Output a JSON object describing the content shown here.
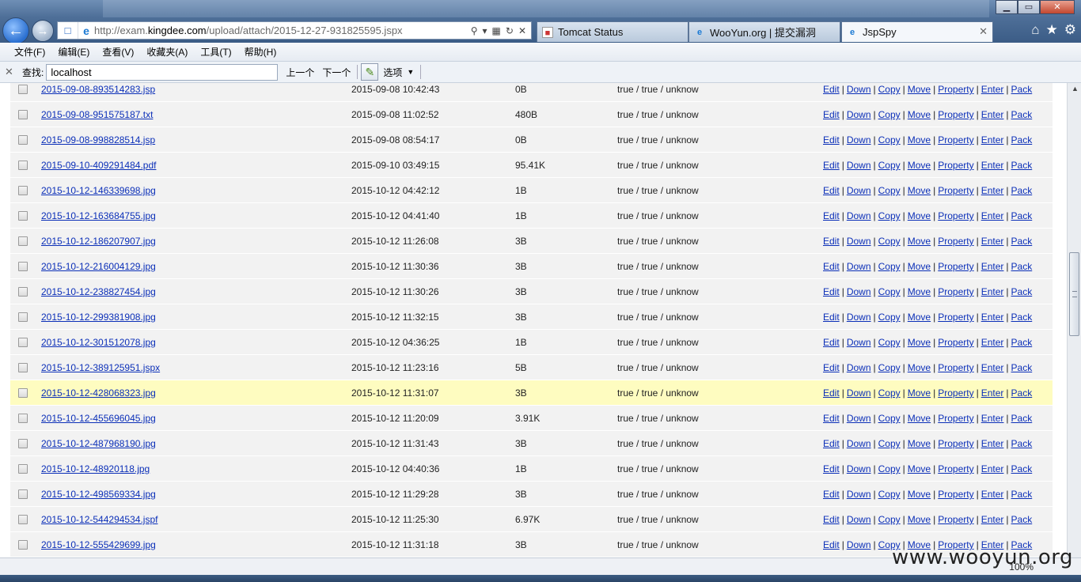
{
  "browser": {
    "address_url_prefix": "http://exam.",
    "address_url_domain": "kingdee.com",
    "address_url_suffix": "/upload/attach/2015-12-27-931825595.jspx",
    "tabs": [
      {
        "label": "Tomcat Status",
        "icon": "tomcat-icon"
      },
      {
        "label": "WooYun.org | 提交漏洞",
        "icon": "ie-icon"
      },
      {
        "label": "JspSpy",
        "icon": "ie-icon",
        "active": true
      }
    ],
    "window_buttons": {
      "minimize": "▁",
      "maximize": "▭",
      "close": "✕"
    }
  },
  "menu": [
    "文件(F)",
    "编辑(E)",
    "查看(V)",
    "收藏夹(A)",
    "工具(T)",
    "帮助(H)"
  ],
  "find": {
    "label": "查找:",
    "value": "localhost",
    "prev": "上一个",
    "next": "下一个",
    "options": "选项"
  },
  "actions": [
    "Edit",
    "Down",
    "Copy",
    "Move",
    "Property",
    "Enter",
    "Pack"
  ],
  "files": [
    {
      "name": "2015-09-08-893514283.jsp",
      "date": "2015-09-08 10:42:43",
      "size": "0B",
      "perm": "true / true / unknow"
    },
    {
      "name": "2015-09-08-951575187.txt",
      "date": "2015-09-08 11:02:52",
      "size": "480B",
      "perm": "true / true / unknow"
    },
    {
      "name": "2015-09-08-998828514.jsp",
      "date": "2015-09-08 08:54:17",
      "size": "0B",
      "perm": "true / true / unknow"
    },
    {
      "name": "2015-09-10-409291484.pdf",
      "date": "2015-09-10 03:49:15",
      "size": "95.41K",
      "perm": "true / true / unknow"
    },
    {
      "name": "2015-10-12-146339698.jpg",
      "date": "2015-10-12 04:42:12",
      "size": "1B",
      "perm": "true / true / unknow"
    },
    {
      "name": "2015-10-12-163684755.jpg",
      "date": "2015-10-12 04:41:40",
      "size": "1B",
      "perm": "true / true / unknow"
    },
    {
      "name": "2015-10-12-186207907.jpg",
      "date": "2015-10-12 11:26:08",
      "size": "3B",
      "perm": "true / true / unknow"
    },
    {
      "name": "2015-10-12-216004129.jpg",
      "date": "2015-10-12 11:30:36",
      "size": "3B",
      "perm": "true / true / unknow"
    },
    {
      "name": "2015-10-12-238827454.jpg",
      "date": "2015-10-12 11:30:26",
      "size": "3B",
      "perm": "true / true / unknow"
    },
    {
      "name": "2015-10-12-299381908.jpg",
      "date": "2015-10-12 11:32:15",
      "size": "3B",
      "perm": "true / true / unknow"
    },
    {
      "name": "2015-10-12-301512078.jpg",
      "date": "2015-10-12 04:36:25",
      "size": "1B",
      "perm": "true / true / unknow"
    },
    {
      "name": "2015-10-12-389125951.jspx",
      "date": "2015-10-12 11:23:16",
      "size": "5B",
      "perm": "true / true / unknow"
    },
    {
      "name": "2015-10-12-428068323.jpg",
      "date": "2015-10-12 11:31:07",
      "size": "3B",
      "perm": "true / true / unknow",
      "highlighted": true
    },
    {
      "name": "2015-10-12-455696045.jpg",
      "date": "2015-10-12 11:20:09",
      "size": "3.91K",
      "perm": "true / true / unknow"
    },
    {
      "name": "2015-10-12-487968190.jpg",
      "date": "2015-10-12 11:31:43",
      "size": "3B",
      "perm": "true / true / unknow"
    },
    {
      "name": "2015-10-12-48920118.jpg",
      "date": "2015-10-12 04:40:36",
      "size": "1B",
      "perm": "true / true / unknow"
    },
    {
      "name": "2015-10-12-498569334.jpg",
      "date": "2015-10-12 11:29:28",
      "size": "3B",
      "perm": "true / true / unknow"
    },
    {
      "name": "2015-10-12-544294534.jspf",
      "date": "2015-10-12 11:25:30",
      "size": "6.97K",
      "perm": "true / true / unknow"
    },
    {
      "name": "2015-10-12-555429699.jpg",
      "date": "2015-10-12 11:31:18",
      "size": "3B",
      "perm": "true / true / unknow"
    }
  ],
  "status": {
    "zoom": "100%"
  },
  "watermark": "www.wooyun.org"
}
